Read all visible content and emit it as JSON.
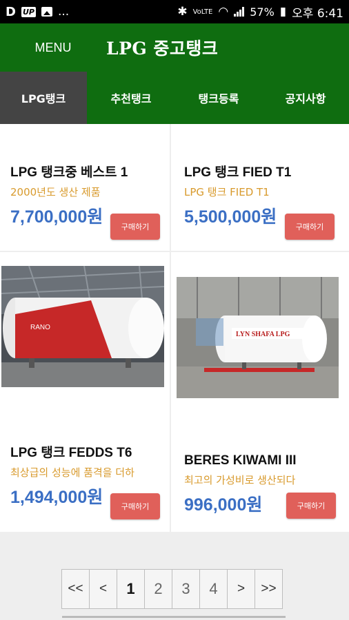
{
  "statusbar": {
    "left_d": "D",
    "left_up": "UP",
    "left_more": "...",
    "volte": "VoLTE",
    "battery": "57%",
    "time": "오후 6:41"
  },
  "header": {
    "menu_label": "MENU",
    "title": "LPG 중고탱크"
  },
  "tabs": [
    {
      "label": "LPG탱크",
      "active": true
    },
    {
      "label": "추천탱크",
      "active": false
    },
    {
      "label": "탱크등록",
      "active": false
    },
    {
      "label": "공지사항",
      "active": false
    }
  ],
  "products": [
    {
      "name": "LPG 탱크중 베스트 1",
      "subtitle": "2000년도 생산 제품",
      "price": "7,700,000원",
      "buy_label": "구매하기"
    },
    {
      "name": "LPG 탱크 FIED T1",
      "subtitle": "LPG 탱크 FIED T1",
      "price": "5,500,000원",
      "buy_label": "구매하기"
    },
    {
      "name": "LPG 탱크 FEDDS T6",
      "subtitle": "최상급의 성능에 품격을 더하",
      "price": "1,494,000원",
      "buy_label": "구매하기",
      "image_text": "RANO"
    },
    {
      "name": "BERES KIWAMI III",
      "subtitle": "최고의 가성비로 생산되다",
      "price": "996,000원",
      "buy_label": "구매하기",
      "image_text": "LYN SHAFA LPG"
    }
  ],
  "pagination": {
    "first": "<<",
    "prev": "<",
    "pages": [
      "1",
      "2",
      "3",
      "4"
    ],
    "current": "1",
    "next": ">",
    "last": ">>"
  },
  "colors": {
    "header_green": "#0f6d10",
    "active_tab": "#444444",
    "subtitle": "#d89a2c",
    "price": "#3b6fc4",
    "buy_button": "#e0605a"
  }
}
